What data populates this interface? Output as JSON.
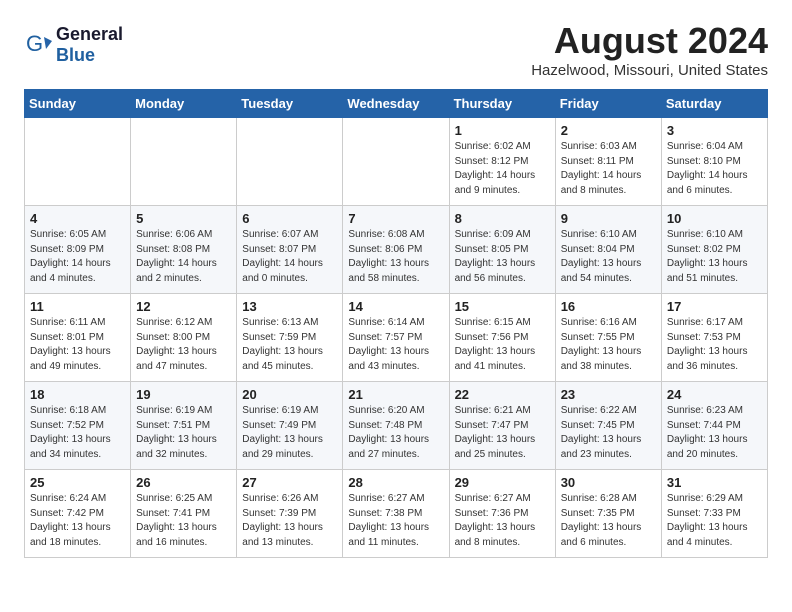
{
  "header": {
    "logo_general": "General",
    "logo_blue": "Blue",
    "month_year": "August 2024",
    "location": "Hazelwood, Missouri, United States"
  },
  "weekdays": [
    "Sunday",
    "Monday",
    "Tuesday",
    "Wednesday",
    "Thursday",
    "Friday",
    "Saturday"
  ],
  "weeks": [
    [
      {
        "day": "",
        "info": ""
      },
      {
        "day": "",
        "info": ""
      },
      {
        "day": "",
        "info": ""
      },
      {
        "day": "",
        "info": ""
      },
      {
        "day": "1",
        "info": "Sunrise: 6:02 AM\nSunset: 8:12 PM\nDaylight: 14 hours\nand 9 minutes."
      },
      {
        "day": "2",
        "info": "Sunrise: 6:03 AM\nSunset: 8:11 PM\nDaylight: 14 hours\nand 8 minutes."
      },
      {
        "day": "3",
        "info": "Sunrise: 6:04 AM\nSunset: 8:10 PM\nDaylight: 14 hours\nand 6 minutes."
      }
    ],
    [
      {
        "day": "4",
        "info": "Sunrise: 6:05 AM\nSunset: 8:09 PM\nDaylight: 14 hours\nand 4 minutes."
      },
      {
        "day": "5",
        "info": "Sunrise: 6:06 AM\nSunset: 8:08 PM\nDaylight: 14 hours\nand 2 minutes."
      },
      {
        "day": "6",
        "info": "Sunrise: 6:07 AM\nSunset: 8:07 PM\nDaylight: 14 hours\nand 0 minutes."
      },
      {
        "day": "7",
        "info": "Sunrise: 6:08 AM\nSunset: 8:06 PM\nDaylight: 13 hours\nand 58 minutes."
      },
      {
        "day": "8",
        "info": "Sunrise: 6:09 AM\nSunset: 8:05 PM\nDaylight: 13 hours\nand 56 minutes."
      },
      {
        "day": "9",
        "info": "Sunrise: 6:10 AM\nSunset: 8:04 PM\nDaylight: 13 hours\nand 54 minutes."
      },
      {
        "day": "10",
        "info": "Sunrise: 6:10 AM\nSunset: 8:02 PM\nDaylight: 13 hours\nand 51 minutes."
      }
    ],
    [
      {
        "day": "11",
        "info": "Sunrise: 6:11 AM\nSunset: 8:01 PM\nDaylight: 13 hours\nand 49 minutes."
      },
      {
        "day": "12",
        "info": "Sunrise: 6:12 AM\nSunset: 8:00 PM\nDaylight: 13 hours\nand 47 minutes."
      },
      {
        "day": "13",
        "info": "Sunrise: 6:13 AM\nSunset: 7:59 PM\nDaylight: 13 hours\nand 45 minutes."
      },
      {
        "day": "14",
        "info": "Sunrise: 6:14 AM\nSunset: 7:57 PM\nDaylight: 13 hours\nand 43 minutes."
      },
      {
        "day": "15",
        "info": "Sunrise: 6:15 AM\nSunset: 7:56 PM\nDaylight: 13 hours\nand 41 minutes."
      },
      {
        "day": "16",
        "info": "Sunrise: 6:16 AM\nSunset: 7:55 PM\nDaylight: 13 hours\nand 38 minutes."
      },
      {
        "day": "17",
        "info": "Sunrise: 6:17 AM\nSunset: 7:53 PM\nDaylight: 13 hours\nand 36 minutes."
      }
    ],
    [
      {
        "day": "18",
        "info": "Sunrise: 6:18 AM\nSunset: 7:52 PM\nDaylight: 13 hours\nand 34 minutes."
      },
      {
        "day": "19",
        "info": "Sunrise: 6:19 AM\nSunset: 7:51 PM\nDaylight: 13 hours\nand 32 minutes."
      },
      {
        "day": "20",
        "info": "Sunrise: 6:19 AM\nSunset: 7:49 PM\nDaylight: 13 hours\nand 29 minutes."
      },
      {
        "day": "21",
        "info": "Sunrise: 6:20 AM\nSunset: 7:48 PM\nDaylight: 13 hours\nand 27 minutes."
      },
      {
        "day": "22",
        "info": "Sunrise: 6:21 AM\nSunset: 7:47 PM\nDaylight: 13 hours\nand 25 minutes."
      },
      {
        "day": "23",
        "info": "Sunrise: 6:22 AM\nSunset: 7:45 PM\nDaylight: 13 hours\nand 23 minutes."
      },
      {
        "day": "24",
        "info": "Sunrise: 6:23 AM\nSunset: 7:44 PM\nDaylight: 13 hours\nand 20 minutes."
      }
    ],
    [
      {
        "day": "25",
        "info": "Sunrise: 6:24 AM\nSunset: 7:42 PM\nDaylight: 13 hours\nand 18 minutes."
      },
      {
        "day": "26",
        "info": "Sunrise: 6:25 AM\nSunset: 7:41 PM\nDaylight: 13 hours\nand 16 minutes."
      },
      {
        "day": "27",
        "info": "Sunrise: 6:26 AM\nSunset: 7:39 PM\nDaylight: 13 hours\nand 13 minutes."
      },
      {
        "day": "28",
        "info": "Sunrise: 6:27 AM\nSunset: 7:38 PM\nDaylight: 13 hours\nand 11 minutes."
      },
      {
        "day": "29",
        "info": "Sunrise: 6:27 AM\nSunset: 7:36 PM\nDaylight: 13 hours\nand 8 minutes."
      },
      {
        "day": "30",
        "info": "Sunrise: 6:28 AM\nSunset: 7:35 PM\nDaylight: 13 hours\nand 6 minutes."
      },
      {
        "day": "31",
        "info": "Sunrise: 6:29 AM\nSunset: 7:33 PM\nDaylight: 13 hours\nand 4 minutes."
      }
    ]
  ]
}
